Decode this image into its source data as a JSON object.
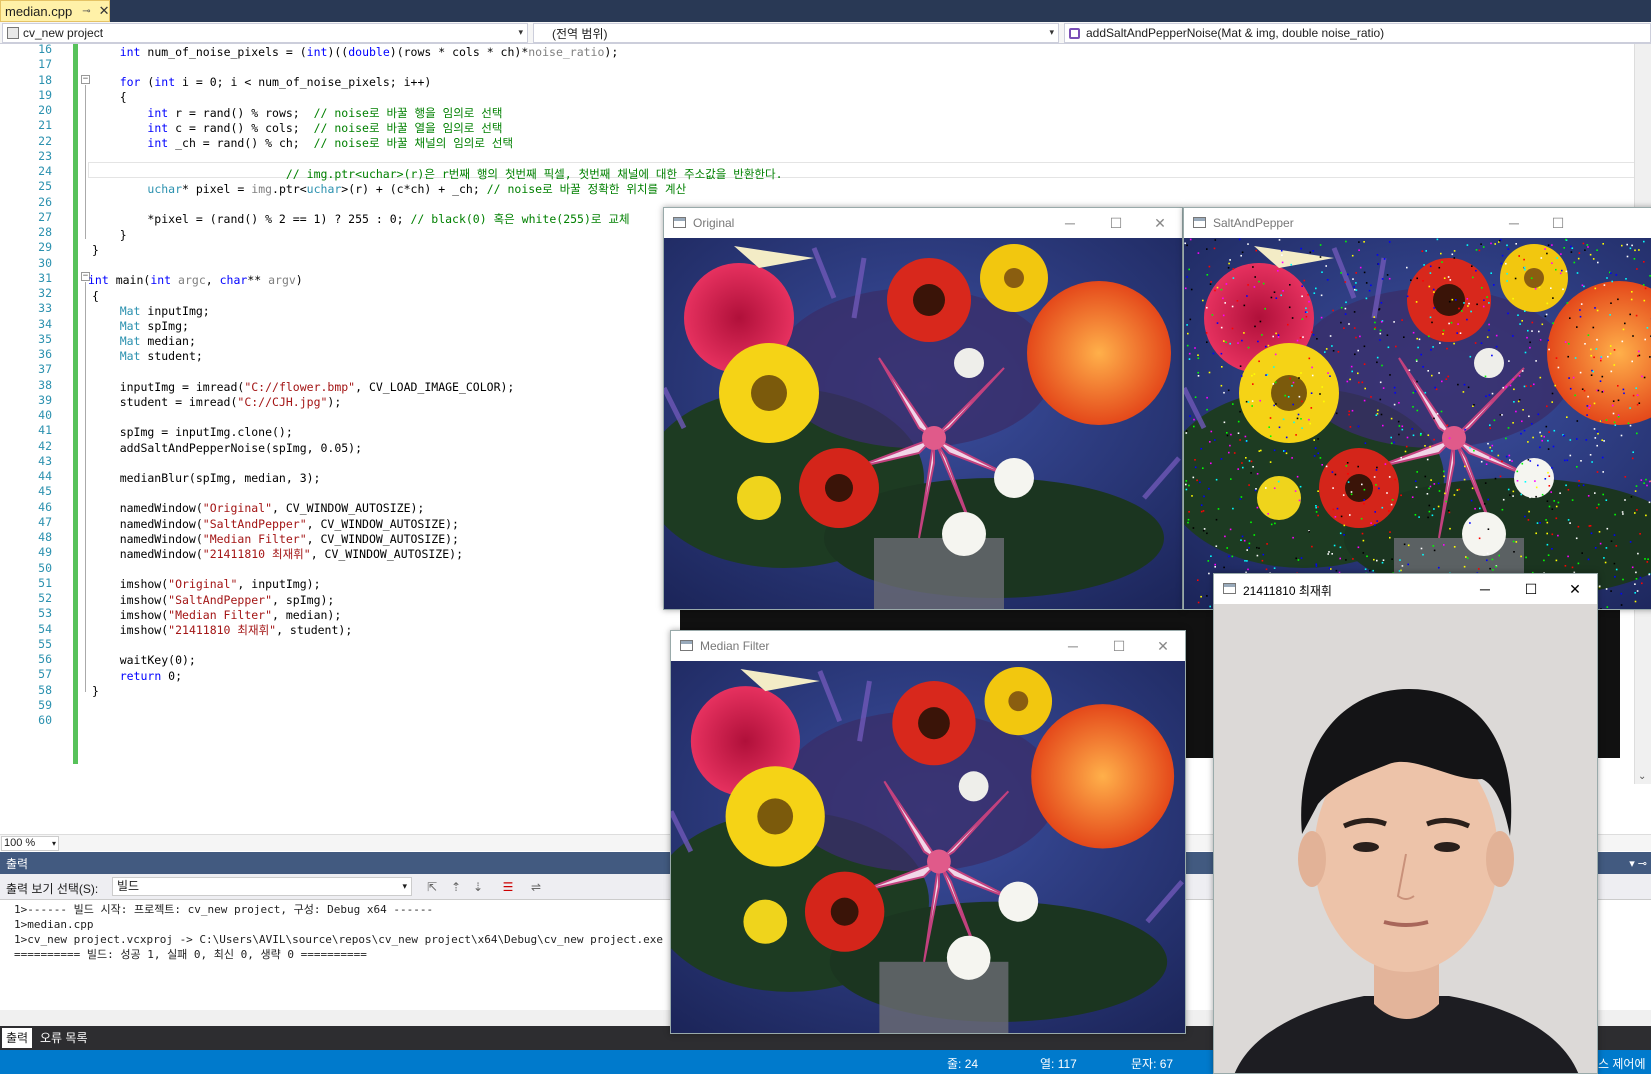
{
  "tab": {
    "filename": "median.cpp",
    "pin": "⊸",
    "close": "✕"
  },
  "nav": {
    "project": "cv_new project",
    "scope": "(전역 범위)",
    "member": "addSaltAndPepperNoise(Mat & img, double noise_ratio)"
  },
  "editor": {
    "line_numbers": [
      "16",
      "17",
      "18",
      "19",
      "20",
      "21",
      "22",
      "23",
      "24",
      "25",
      "26",
      "27",
      "28",
      "29",
      "30",
      "31",
      "32",
      "33",
      "34",
      "35",
      "36",
      "37",
      "38",
      "39",
      "40",
      "41",
      "42",
      "43",
      "44",
      "45",
      "46",
      "47",
      "48",
      "49",
      "50",
      "51",
      "52",
      "53",
      "54",
      "55",
      "56",
      "57",
      "58",
      "59",
      "60"
    ],
    "zoom": "100 %"
  },
  "output": {
    "title": "출력",
    "show_from_label": "출력 보기 선택(S):",
    "show_from_value": "빌드",
    "lines": [
      "1>------ 빌드 시작: 프로젝트: cv_new project, 구성: Debug x64 ------",
      "1>median.cpp",
      "1>cv_new project.vcxproj -> C:\\Users\\AVIL\\source\\repos\\cv_new project\\x64\\Debug\\cv_new project.exe",
      "========== 빌드: 성공 1, 실패 0, 최신 0, 생략 0 =========="
    ]
  },
  "bottom_tabs": {
    "output": "출력",
    "errors": "오류 목록"
  },
  "status": {
    "line": "줄: 24",
    "col": "열: 117",
    "ch": "문자: 67",
    "right": "스 제어에"
  },
  "windows": {
    "original": "Original",
    "salt": "SaltAndPepper",
    "median": "Median Filter",
    "student": "21411810 최재휘",
    "minimize": "─",
    "maximize": "☐",
    "close": "✕"
  },
  "colors": {
    "tab_bg": "#fff1a8",
    "frame": "#293955",
    "output_header": "#425a80",
    "statusbar": "#007acc",
    "keyword": "#0000ff",
    "type": "#2b91af",
    "comment": "#008000",
    "string": "#a31515"
  }
}
